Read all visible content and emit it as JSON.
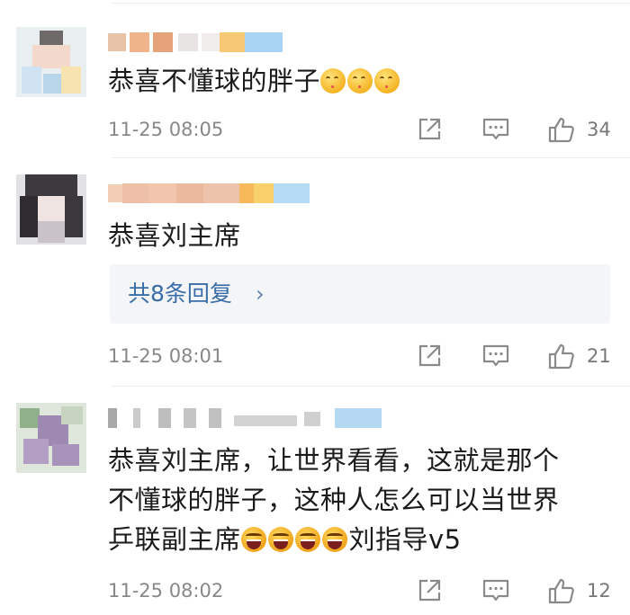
{
  "comments": [
    {
      "text_parts": [
        {
          "kind": "text",
          "value": "恭喜不懂球的胖子"
        },
        {
          "kind": "emoji",
          "icon": "kiss-emoji"
        },
        {
          "kind": "emoji",
          "icon": "kiss-emoji"
        },
        {
          "kind": "emoji",
          "icon": "kiss-emoji"
        }
      ],
      "timestamp": "11-25 08:05",
      "likes": "34"
    },
    {
      "text_parts": [
        {
          "kind": "text",
          "value": "恭喜刘主席"
        }
      ],
      "replies_label": "共8条回复",
      "replies_chevron": "›",
      "timestamp": "11-25 08:01",
      "likes": "21"
    },
    {
      "text_parts": [
        {
          "kind": "text",
          "value": "恭喜刘主席，让世界看看，这就是那个\n不懂球的胖子，这种人怎么可以当世界\n乒联副主席"
        },
        {
          "kind": "emoji",
          "icon": "laughing-emoji"
        },
        {
          "kind": "emoji",
          "icon": "laughing-emoji"
        },
        {
          "kind": "emoji",
          "icon": "laughing-emoji"
        },
        {
          "kind": "emoji",
          "icon": "laughing-emoji"
        },
        {
          "kind": "text",
          "value": "刘指导v5"
        }
      ],
      "timestamp": "11-25 08:02",
      "likes": "12"
    }
  ],
  "colors": {
    "reply_link": "#3a6da8",
    "meta_text": "#888888",
    "icon_stroke": "#8a8a8a"
  }
}
